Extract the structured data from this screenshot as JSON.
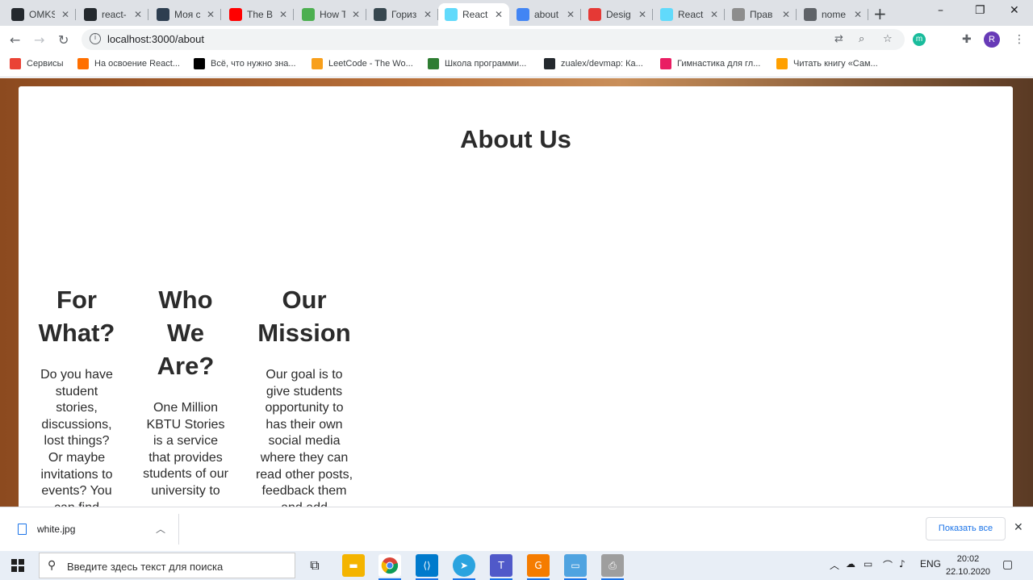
{
  "browser": {
    "tabs": [
      {
        "title": "OMKS",
        "icon": "github-icon",
        "color": "#24292e"
      },
      {
        "title": "react-",
        "icon": "github-icon",
        "color": "#24292e"
      },
      {
        "title": "Моя с",
        "icon": "dots-icon",
        "color": "#2d3e50"
      },
      {
        "title": "The B",
        "icon": "youtube-icon",
        "color": "#ff0000"
      },
      {
        "title": "How T",
        "icon": "w3schools-icon",
        "color": "#4caf50"
      },
      {
        "title": "Гориз",
        "icon": "gear-icon",
        "color": "#37474f"
      },
      {
        "title": "React",
        "icon": "react-icon",
        "color": "#61dafb",
        "active": true
      },
      {
        "title": "about",
        "icon": "google-icon",
        "color": "#4285f4"
      },
      {
        "title": "Desig",
        "icon": "design-icon",
        "color": "#e53935"
      },
      {
        "title": "React",
        "icon": "react-icon",
        "color": "#61dafb"
      },
      {
        "title": "Прав",
        "icon": "tumblr-icon",
        "color": "#8d8d8d"
      },
      {
        "title": "nome",
        "icon": "globe-icon",
        "color": "#5f6368"
      }
    ],
    "url": "localhost:3000/about",
    "bookmarks": [
      {
        "label": "Сервисы",
        "icon": "apps-icon",
        "color": "#ea4335"
      },
      {
        "label": "На освоение React...",
        "icon": "bookmark-icon",
        "color": "#ff6f00"
      },
      {
        "label": "Всё, что нужно зна...",
        "icon": "medium-icon",
        "color": "#000000"
      },
      {
        "label": "LeetCode - The Wo...",
        "icon": "leetcode-icon",
        "color": "#f89f1b"
      },
      {
        "label": "Школа программи...",
        "icon": "acmp-icon",
        "color": "#2e7d32"
      },
      {
        "label": "zualex/devmap: Ка...",
        "icon": "github-icon",
        "color": "#24292e"
      },
      {
        "label": "Гимнастика для гл...",
        "icon": "flower-icon",
        "color": "#e91e63"
      },
      {
        "label": "Читать книгу «Сам...",
        "icon": "book-icon",
        "color": "#ffa000"
      }
    ]
  },
  "page": {
    "heading": "About Us",
    "columns": [
      {
        "title": "For What?",
        "text": "Do you have student stories, discussions, lost things? Or maybe invitations to events? You can find"
      },
      {
        "title": "Who We Are?",
        "text": "One Million KBTU Stories is a service that provides students of our university to"
      },
      {
        "title": "Our Mission",
        "text": "Our goal is to give students opportunity to has their own social media where they can read other posts, feedback them and add"
      }
    ]
  },
  "downloads": {
    "filename": "white.jpg",
    "show_all": "Показать все"
  },
  "taskbar": {
    "search_placeholder": "Введите здесь текст для поиска",
    "lang": "ENG",
    "time": "20:02",
    "date": "22.10.2020"
  }
}
